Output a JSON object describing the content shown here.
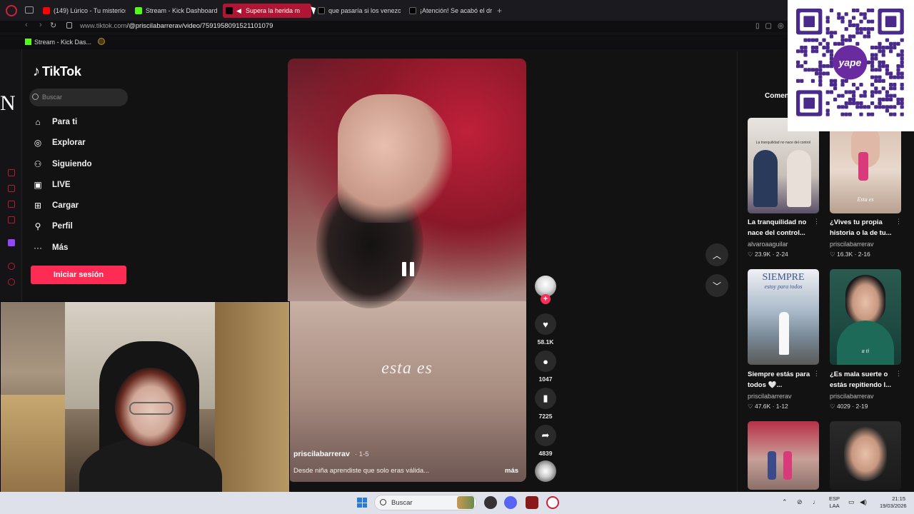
{
  "browser": {
    "tabs": [
      {
        "label": "(149) Lúrico - Tu misterios",
        "icon_color": "#ff0000"
      },
      {
        "label": "Stream - Kick Dashboard",
        "icon_color": "#53fc18"
      },
      {
        "label": "Supera la herida m",
        "icon_color": "#ffffff",
        "active": true
      },
      {
        "label": "que pasaría si los venezol",
        "icon_color": "#ffffff"
      },
      {
        "label": "¡Atención! Se acabó el dra",
        "icon_color": "#ffffff"
      }
    ],
    "url_domain": "www.tiktok.com",
    "url_path": "/@priscilabarrerav/video/7591958091521101079",
    "bookmark_label": "Stream - Kick Das..."
  },
  "tiktok": {
    "logo_text": "TikTok",
    "search_placeholder": "Buscar",
    "menu": [
      {
        "label": "Para ti",
        "icon": "home-icon"
      },
      {
        "label": "Explorar",
        "icon": "compass-icon"
      },
      {
        "label": "Siguiendo",
        "icon": "following-icon"
      },
      {
        "label": "LIVE",
        "icon": "live-icon"
      },
      {
        "label": "Cargar",
        "icon": "upload-icon"
      },
      {
        "label": "Perfil",
        "icon": "profile-icon"
      },
      {
        "label": "Más",
        "icon": "more-icon"
      }
    ],
    "login_label": "Iniciar sesión",
    "video": {
      "overlay_text": "esta es",
      "author": "priscilabarrerav",
      "date": "· 1-5",
      "description": "Desde niña aprendiste que solo eras válida...",
      "more_label": "más"
    },
    "actions": {
      "likes": "58.1K",
      "comments": "1047",
      "saves": "7225",
      "shares": "4839"
    },
    "right_panel": {
      "tab_label": "Comen",
      "recommendations": [
        {
          "title": "La tranquilidad no nace del control...",
          "author": "alvaroaaguilar",
          "likes": "23.9K",
          "date": "2-24",
          "thumb_caption": "La tranquilidad no nace del control"
        },
        {
          "title": "¿Vives tu propia historia o la de tu...",
          "author": "priscilabarrerav",
          "likes": "16.3K",
          "date": "2-16",
          "thumb_caption": "Esta es"
        },
        {
          "title": "Siempre estás para todos 🤍...",
          "author": "priscilabarrerav",
          "likes": "47.6K",
          "date": "1-12",
          "thumb_caption": "SIEMPRE",
          "thumb_caption2": "estoy para todos"
        },
        {
          "title": "¿Es mala suerte o estás repitiendo l...",
          "author": "priscilabarrerav",
          "likes": "4029",
          "date": "2-19",
          "thumb_caption": "a ti"
        }
      ]
    }
  },
  "sidestrip": {
    "letter": "N"
  },
  "qr": {
    "brand": "yape"
  },
  "taskbar": {
    "search_label": "Buscar",
    "lang_line1": "ESP",
    "lang_line2": "LAA",
    "time": "21:15",
    "date": "19/03/2026"
  }
}
